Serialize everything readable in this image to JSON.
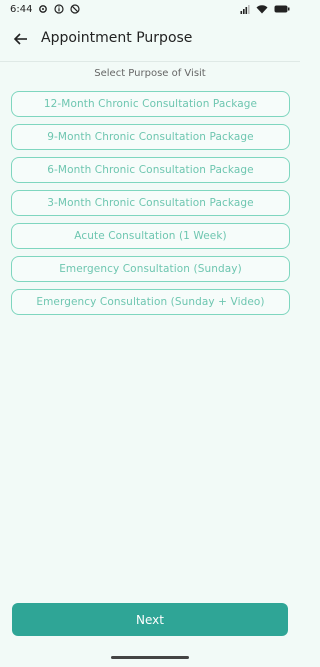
{
  "status_bar": {
    "time": "6:44",
    "left_icons": [
      "settings-icon",
      "info-icon",
      "do-not-disturb-icon"
    ],
    "right_icons": [
      "signal-icon",
      "wifi-icon",
      "battery-icon"
    ]
  },
  "app_bar": {
    "title": "Appointment Purpose",
    "back_icon": "arrow-back-icon"
  },
  "subtitle": "Select Purpose of Visit",
  "options": [
    "12-Month Chronic Consultation Package",
    "9-Month Chronic Consultation Package",
    "6-Month Chronic Consultation Package",
    "3-Month Chronic Consultation Package",
    "Acute Consultation (1 Week)",
    "Emergency Consultation (Sunday)",
    "Emergency Consultation (Sunday + Video)"
  ],
  "next_button": "Next",
  "colors": {
    "accent": "#2fa596",
    "option_border": "#7fd6bf",
    "option_text": "#6ec6b0",
    "background": "#f2faf7"
  }
}
